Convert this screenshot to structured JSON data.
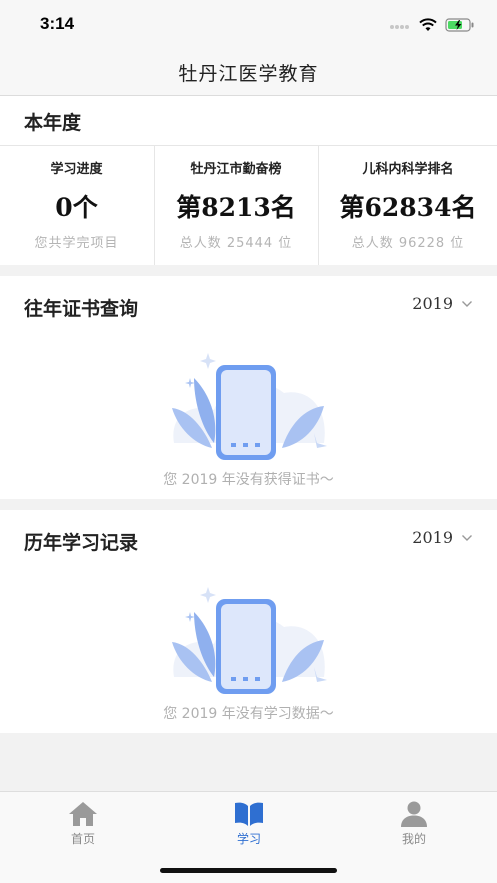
{
  "status_bar": {
    "time": "3:14"
  },
  "nav": {
    "title": "牡丹江医学教育"
  },
  "annual": {
    "title": "本年度",
    "stats": [
      {
        "label": "学习进度",
        "value": "0个",
        "sub": "您共学完项目"
      },
      {
        "label": "牡丹江市勤奋榜",
        "value": "第8213名",
        "sub": "总人数  25444  位"
      },
      {
        "label": "儿科内科学排名",
        "value": "第62834名",
        "sub": "总人数  96228  位"
      }
    ]
  },
  "cert_section": {
    "title": "往年证书查询",
    "year": "2019",
    "empty_text": "您 2019 年没有获得证书～"
  },
  "record_section": {
    "title": "历年学习记录",
    "year": "2019",
    "empty_text": "您 2019 年没有学习数据～"
  },
  "tabs": [
    {
      "label": "首页",
      "icon": "home-icon",
      "active": false
    },
    {
      "label": "学习",
      "icon": "book-icon",
      "active": true
    },
    {
      "label": "我的",
      "icon": "user-icon",
      "active": false
    }
  ],
  "colors": {
    "accent": "#2f6fd1",
    "inactive": "#8a8a8a",
    "illustration": "#6f9df0"
  }
}
